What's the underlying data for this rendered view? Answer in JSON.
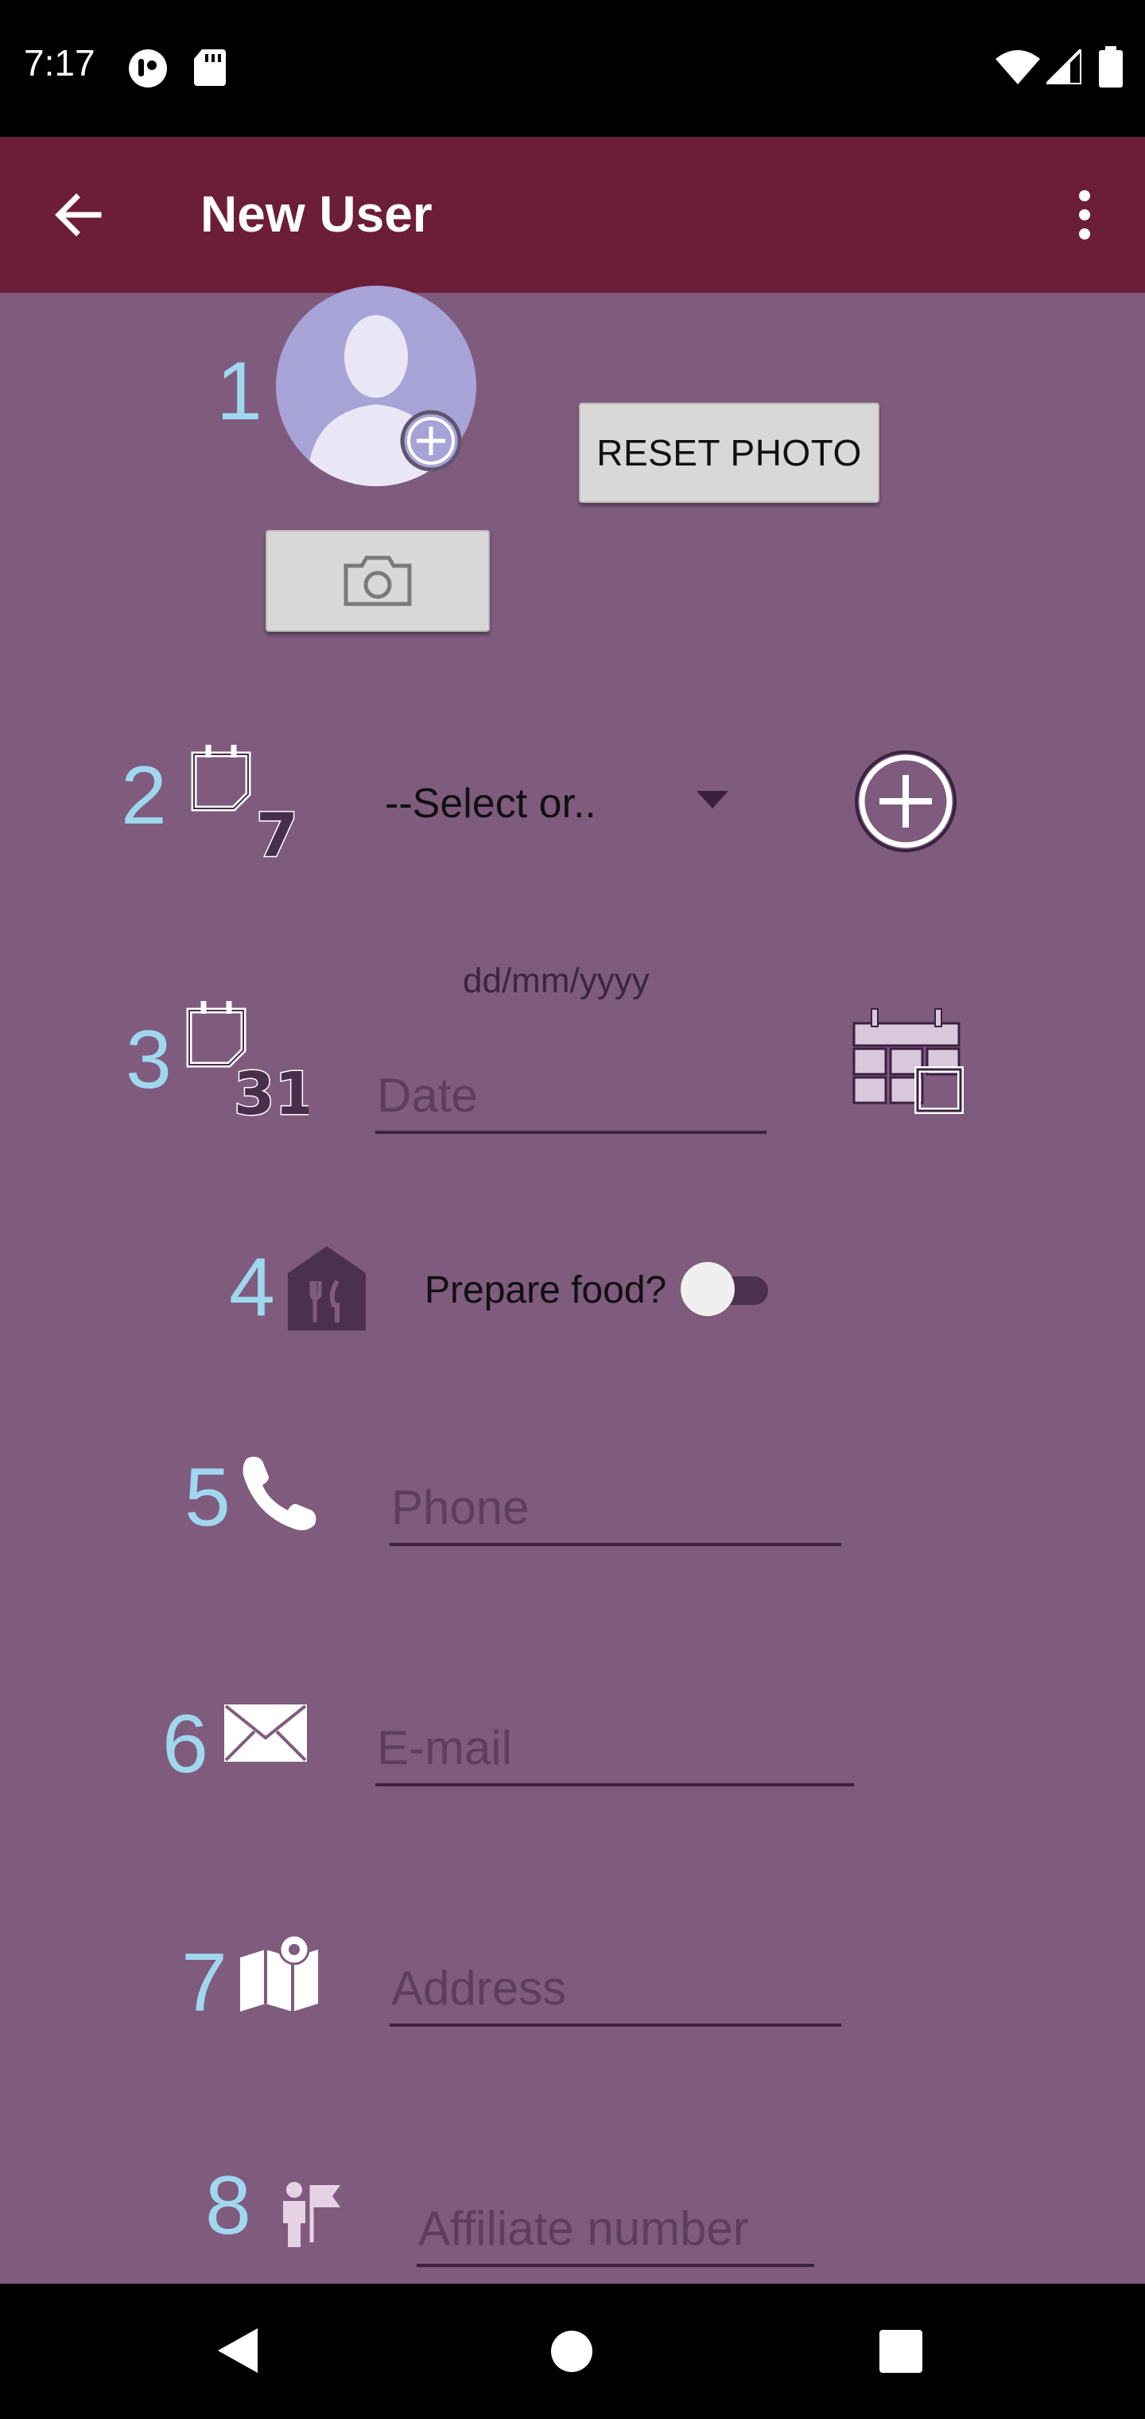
{
  "status_bar": {
    "time": "7:17",
    "icons": [
      "media-app-icon",
      "sd-card-icon",
      "wifi-icon",
      "signal-icon",
      "battery-icon"
    ]
  },
  "app_bar": {
    "title": "New User",
    "back_icon": "arrow-back-icon",
    "menu_icon": "more-vert-icon",
    "color": "#6c1d37"
  },
  "form": {
    "background": "#7f5b7e",
    "step_color": "#9fd7ee",
    "photo": {
      "step": "1",
      "reset_label": "RESET PHOTO",
      "camera_icon": "camera-icon"
    },
    "schedule": {
      "step": "2",
      "icon": "calendar-week-icon",
      "icon_number": "7",
      "selected": "--Select or..",
      "add_icon": "add-circle-icon"
    },
    "date": {
      "step": "3",
      "icon": "calendar-month-icon",
      "icon_number": "31",
      "hint": "dd/mm/yyyy",
      "placeholder": "Date",
      "picker_icon": "calendar-picker-icon"
    },
    "food": {
      "step": "4",
      "icon": "restaurant-icon",
      "label": "Prepare food?",
      "enabled": false
    },
    "phone": {
      "step": "5",
      "icon": "phone-icon",
      "placeholder": "Phone"
    },
    "email": {
      "step": "6",
      "icon": "envelope-icon",
      "placeholder": "E-mail"
    },
    "address": {
      "step": "7",
      "icon": "map-pin-icon",
      "placeholder": "Address"
    },
    "affiliate": {
      "step": "8",
      "icon": "person-flag-icon",
      "placeholder": "Affiliate number"
    }
  },
  "nav_bar": {
    "icons": [
      "back-triangle-icon",
      "home-circle-icon",
      "recents-square-icon"
    ]
  }
}
